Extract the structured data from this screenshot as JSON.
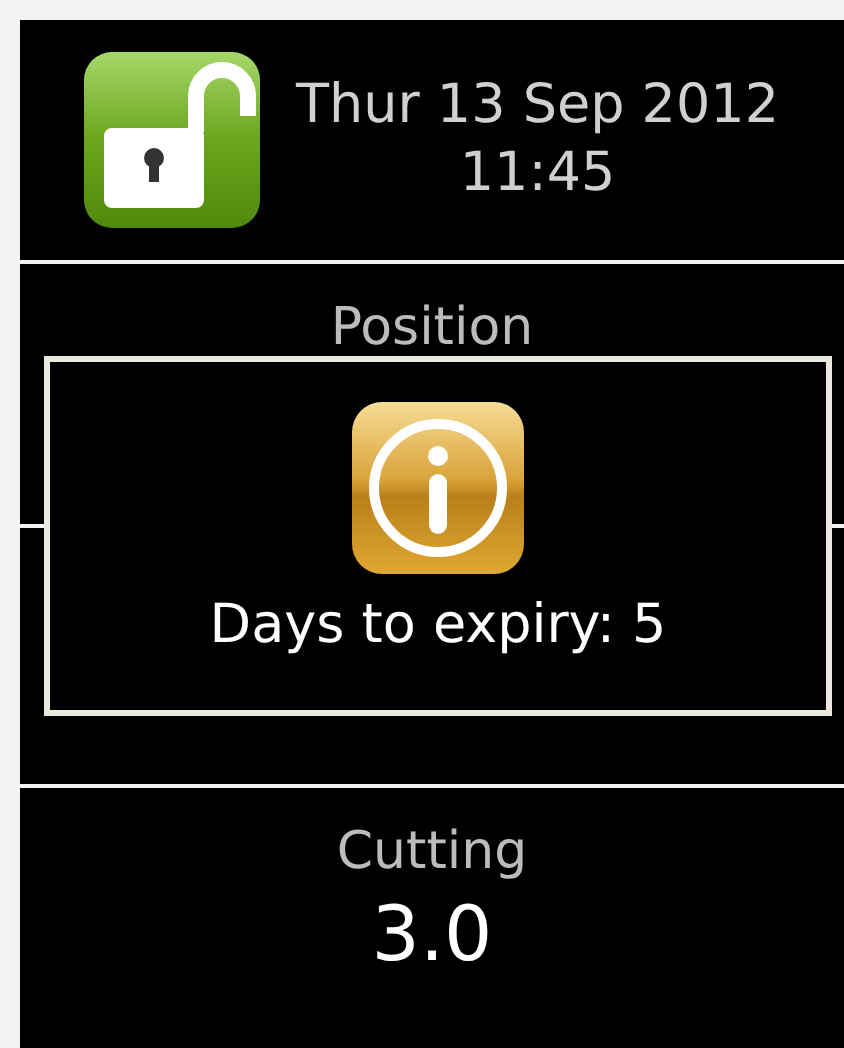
{
  "header": {
    "locked": false,
    "date": "Thur 13 Sep 2012",
    "time": "11:45"
  },
  "readouts": [
    {
      "kind": "readout",
      "label": "Position"
    },
    {
      "kind": "blank"
    },
    {
      "kind": "readout",
      "label": "Cutting",
      "value": "3.0"
    }
  ],
  "dialog": {
    "kind": "info",
    "message": "Days to expiry: 5"
  }
}
